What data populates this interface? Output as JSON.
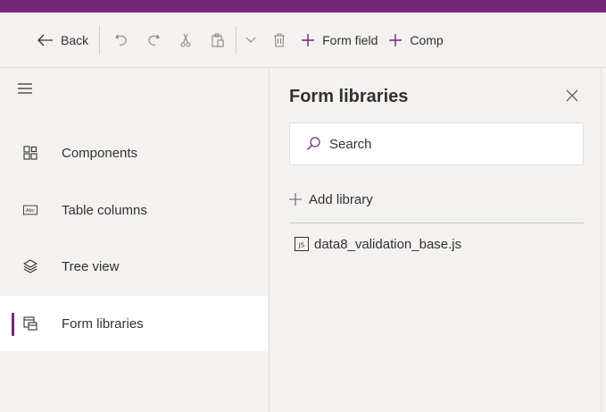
{
  "toolbar": {
    "back_label": "Back",
    "form_field_label": "Form field",
    "component_label": "Comp",
    "accent_color": "#742774"
  },
  "nav": {
    "items": [
      {
        "label": "Components",
        "icon": "components-icon"
      },
      {
        "label": "Table columns",
        "icon": "table-columns-icon"
      },
      {
        "label": "Tree view",
        "icon": "tree-view-icon"
      },
      {
        "label": "Form libraries",
        "icon": "form-libraries-icon",
        "active": true
      }
    ]
  },
  "panel": {
    "title": "Form libraries",
    "search_placeholder": "Search",
    "add_library_label": "Add library",
    "libraries": [
      {
        "name": "data8_validation_base.js",
        "icon": "js-file-icon"
      }
    ]
  }
}
